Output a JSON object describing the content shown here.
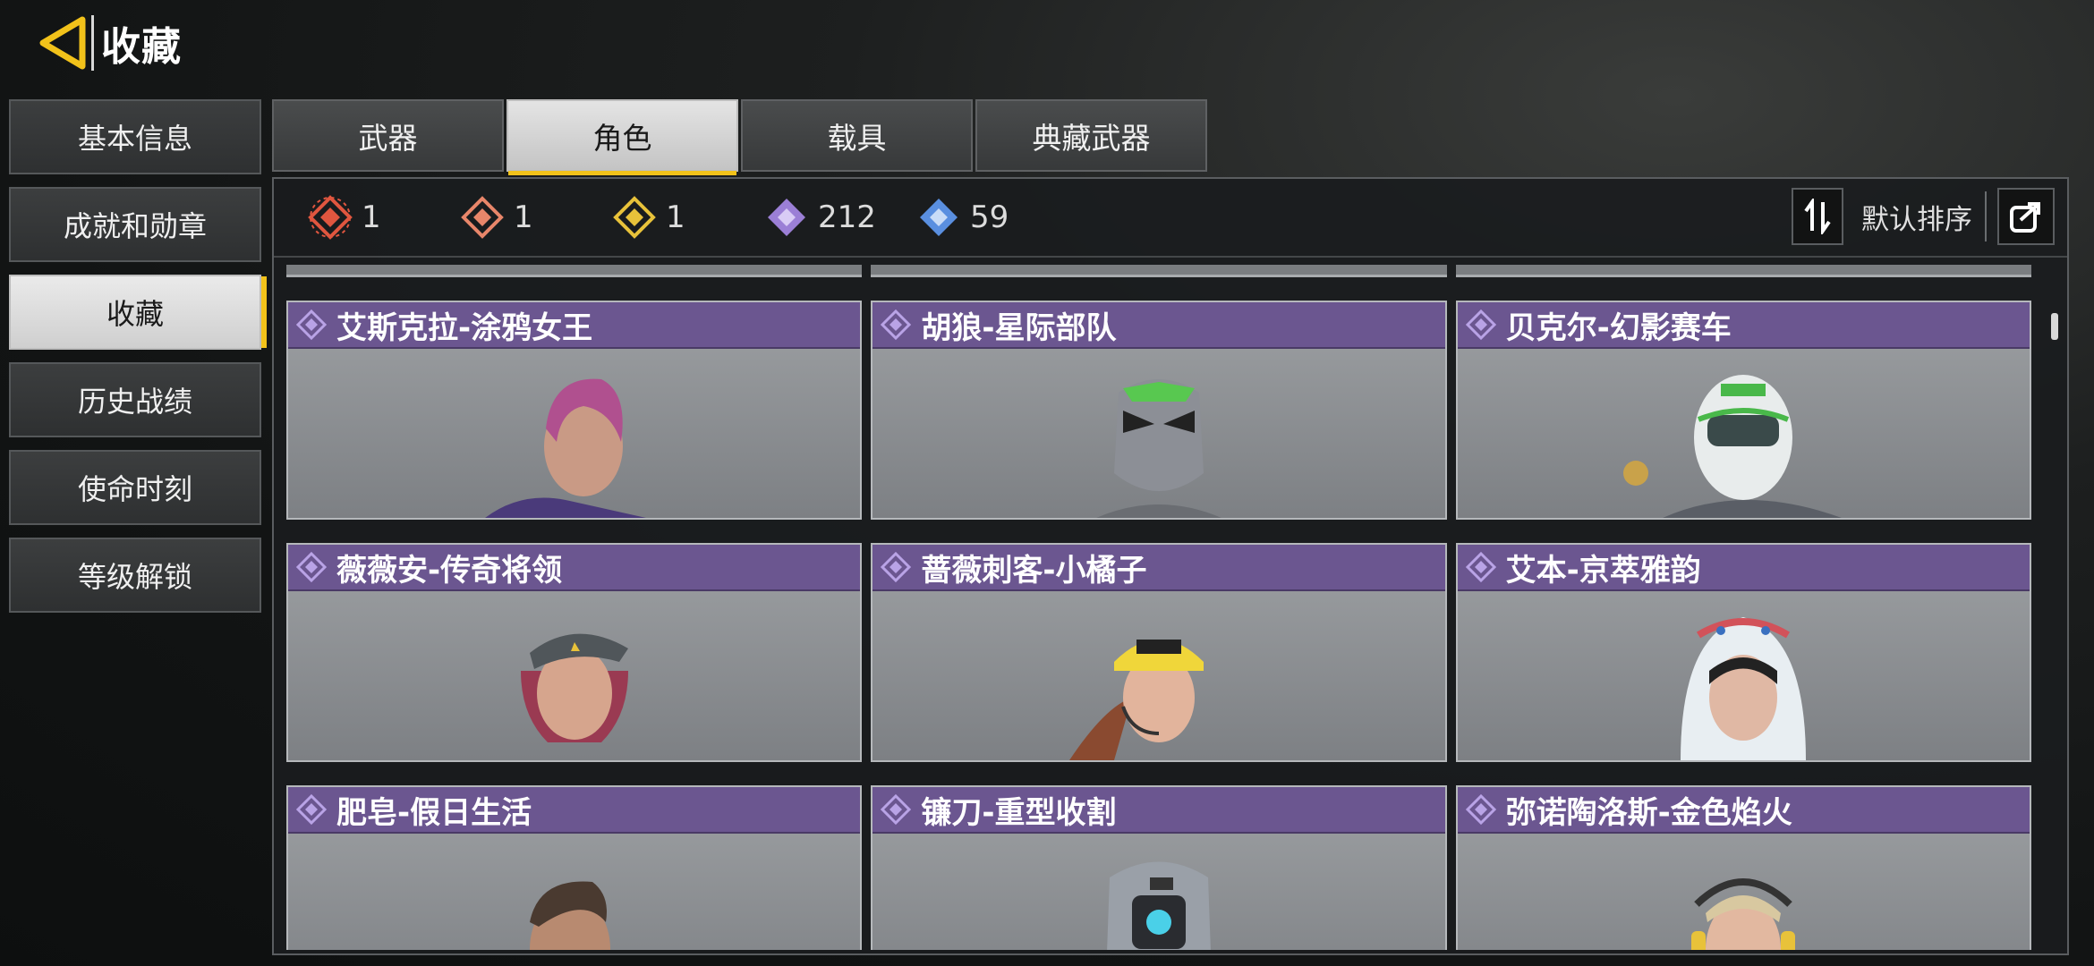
{
  "header": {
    "title": "收藏"
  },
  "sidebar": {
    "items": [
      {
        "label": "基本信息",
        "active": false
      },
      {
        "label": "成就和勋章",
        "active": false
      },
      {
        "label": "收藏",
        "active": true
      },
      {
        "label": "历史战绩",
        "active": false
      },
      {
        "label": "使命时刻",
        "active": false
      },
      {
        "label": "等级解锁",
        "active": false
      }
    ]
  },
  "tabs": [
    {
      "label": "武器",
      "active": false
    },
    {
      "label": "角色",
      "active": true
    },
    {
      "label": "载具",
      "active": false
    },
    {
      "label": "典藏武器",
      "active": false
    }
  ],
  "stats": [
    {
      "icon": "red-mythic-diamond-icon",
      "color": "#e0563f",
      "count": "1"
    },
    {
      "icon": "orange-legendary-diamond-icon",
      "color": "#e8866a",
      "count": "1"
    },
    {
      "icon": "gold-legendary-diamond-icon",
      "color": "#e8c23a",
      "count": "1"
    },
    {
      "icon": "purple-epic-diamond-icon",
      "color": "#9b7fd6",
      "count": "212"
    },
    {
      "icon": "blue-rare-diamond-icon",
      "color": "#5a8fe0",
      "count": "59"
    }
  ],
  "sort": {
    "label": "默认排序"
  },
  "cards": [
    {
      "name": "艾斯克拉-涂鸦女王"
    },
    {
      "name": "胡狼-星际部队"
    },
    {
      "name": "贝克尔-幻影赛车"
    },
    {
      "name": "薇薇安-传奇将领"
    },
    {
      "name": "蔷薇刺客-小橘子"
    },
    {
      "name": "艾本-京萃雅韵"
    },
    {
      "name": "肥皂-假日生活"
    },
    {
      "name": "镰刀-重型收割"
    },
    {
      "name": "弥诺陶洛斯-金色焰火"
    }
  ],
  "colors": {
    "accent": "#f2c21a",
    "card_header": "#6b5690",
    "rarity_epic": "#9b7fd6"
  }
}
